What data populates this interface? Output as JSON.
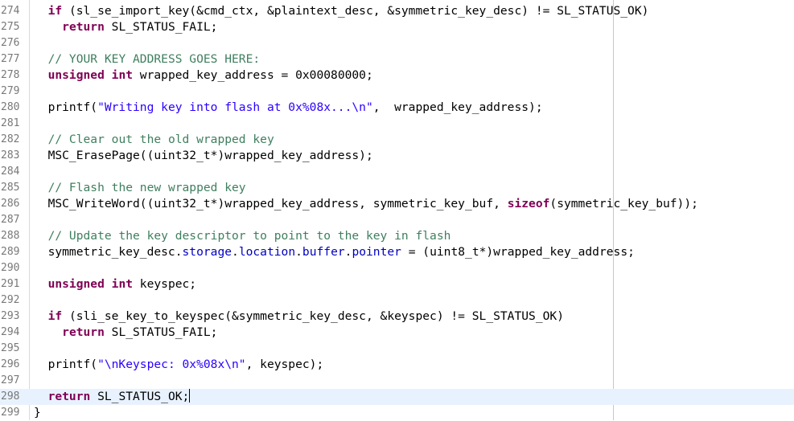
{
  "editor": {
    "current_line": "298",
    "lines": [
      {
        "n": "274",
        "tokens": [
          {
            "t": "  "
          },
          {
            "t": "if",
            "c": "kw"
          },
          {
            "t": " (sl_se_import_key(&cmd_ctx, &plaintext_desc, &symmetric_key_desc) != SL_STATUS_OK)"
          }
        ]
      },
      {
        "n": "275",
        "tokens": [
          {
            "t": "    "
          },
          {
            "t": "return",
            "c": "kw"
          },
          {
            "t": " SL_STATUS_FAIL;"
          }
        ]
      },
      {
        "n": "276",
        "tokens": []
      },
      {
        "n": "277",
        "tokens": [
          {
            "t": "  "
          },
          {
            "t": "// YOUR KEY ADDRESS GOES HERE:",
            "c": "cm"
          }
        ]
      },
      {
        "n": "278",
        "tokens": [
          {
            "t": "  "
          },
          {
            "t": "unsigned int",
            "c": "kw"
          },
          {
            "t": " wrapped_key_address = 0x00080000;"
          }
        ]
      },
      {
        "n": "279",
        "tokens": []
      },
      {
        "n": "280",
        "tokens": [
          {
            "t": "  printf("
          },
          {
            "t": "\"Writing key into flash at 0x%08x...\\n\"",
            "c": "st"
          },
          {
            "t": ",  wrapped_key_address);"
          }
        ]
      },
      {
        "n": "281",
        "tokens": []
      },
      {
        "n": "282",
        "tokens": [
          {
            "t": "  "
          },
          {
            "t": "// Clear out the old wrapped key",
            "c": "cm"
          }
        ]
      },
      {
        "n": "283",
        "tokens": [
          {
            "t": "  MSC_ErasePage((uint32_t*)wrapped_key_address);"
          }
        ]
      },
      {
        "n": "284",
        "tokens": []
      },
      {
        "n": "285",
        "tokens": [
          {
            "t": "  "
          },
          {
            "t": "// Flash the new wrapped key",
            "c": "cm"
          }
        ]
      },
      {
        "n": "286",
        "tokens": [
          {
            "t": "  MSC_WriteWord((uint32_t*)wrapped_key_address, symmetric_key_buf, "
          },
          {
            "t": "sizeof",
            "c": "kw"
          },
          {
            "t": "(symmetric_key_buf));"
          }
        ]
      },
      {
        "n": "287",
        "tokens": []
      },
      {
        "n": "288",
        "tokens": [
          {
            "t": "  "
          },
          {
            "t": "// Update the key descriptor to point to the key in flash",
            "c": "cm"
          }
        ]
      },
      {
        "n": "289",
        "tokens": [
          {
            "t": "  symmetric_key_desc."
          },
          {
            "t": "storage",
            "c": "fld"
          },
          {
            "t": "."
          },
          {
            "t": "location",
            "c": "fld"
          },
          {
            "t": "."
          },
          {
            "t": "buffer",
            "c": "fld"
          },
          {
            "t": "."
          },
          {
            "t": "pointer",
            "c": "fld"
          },
          {
            "t": " = (uint8_t*)wrapped_key_address;"
          }
        ]
      },
      {
        "n": "290",
        "tokens": []
      },
      {
        "n": "291",
        "tokens": [
          {
            "t": "  "
          },
          {
            "t": "unsigned int",
            "c": "kw"
          },
          {
            "t": " keyspec;"
          }
        ]
      },
      {
        "n": "292",
        "tokens": []
      },
      {
        "n": "293",
        "tokens": [
          {
            "t": "  "
          },
          {
            "t": "if",
            "c": "kw"
          },
          {
            "t": " (sli_se_key_to_keyspec(&symmetric_key_desc, &keyspec) != SL_STATUS_OK)"
          }
        ]
      },
      {
        "n": "294",
        "tokens": [
          {
            "t": "    "
          },
          {
            "t": "return",
            "c": "kw"
          },
          {
            "t": " SL_STATUS_FAIL;"
          }
        ]
      },
      {
        "n": "295",
        "tokens": []
      },
      {
        "n": "296",
        "tokens": [
          {
            "t": "  printf("
          },
          {
            "t": "\"\\nKeyspec: 0x%08x\\n\"",
            "c": "st"
          },
          {
            "t": ", keyspec);"
          }
        ]
      },
      {
        "n": "297",
        "tokens": []
      },
      {
        "n": "298",
        "tokens": [
          {
            "t": "  "
          },
          {
            "t": "return",
            "c": "kw"
          },
          {
            "t": " SL_STATUS_OK;"
          }
        ]
      },
      {
        "n": "299",
        "tokens": [
          {
            "t": "}"
          }
        ]
      }
    ]
  }
}
